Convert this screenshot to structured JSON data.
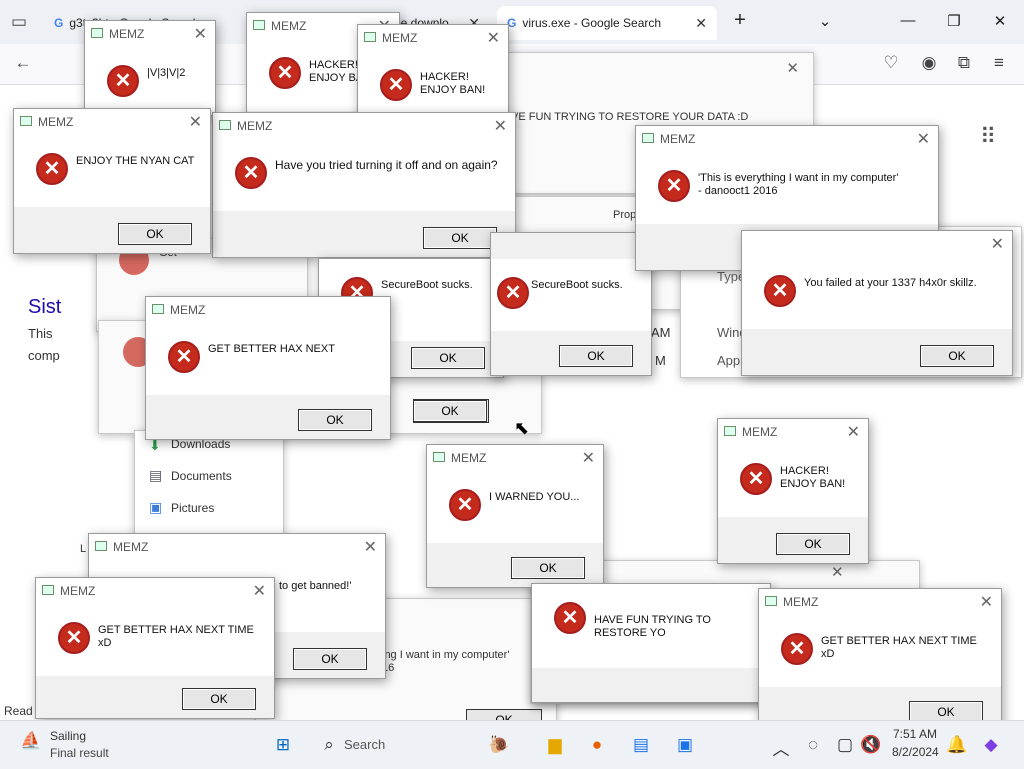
{
  "browser": {
    "tabs": [
      {
        "label": "g3tc3bt - Google Search"
      },
      {
        "label": "ree downlo"
      },
      {
        "label": "virus.exe - Google Search"
      }
    ],
    "new_tab": "+",
    "tab_list": "⌄"
  },
  "background": {
    "heading": "Sist",
    "line1": "This",
    "line2": "comp",
    "get_label": "Get",
    "ok_label": "OK",
    "props": "Prop",
    "type": "Type",
    "am1": "AM",
    "am2": "M",
    "win1": "Wind",
    "win2": "Appl",
    "downloads": "Downloads",
    "documents": "Documents",
    "pictures": "Pictures",
    "letter_l": "L",
    "read": "Read",
    "dialog_text_1": "to get banned!'",
    "dialog_text_2": "ing I want in my computer'\n16",
    "fun_text": "VE FUN TRYING TO RESTORE YOUR DATA :D"
  },
  "dialogs": [
    {
      "title": "MEMZ",
      "message": "|V|3|V|2",
      "ok": "OK"
    },
    {
      "title": "MEMZ",
      "message": "HACKER!\nENJOY BA",
      "ok": "OK"
    },
    {
      "title": "MEMZ",
      "message": "HACKER!\nENJOY BAN!",
      "ok": "OK"
    },
    {
      "title": "MEMZ",
      "message": "ENJOY THE NYAN CAT",
      "ok": "OK"
    },
    {
      "title": "MEMZ",
      "message": "Have you tried turning it off and on again?",
      "ok": "OK"
    },
    {
      "title": "MEMZ",
      "message": "'This is everything I want in my computer'\n - danooct1 2016",
      "ok": "OK"
    },
    {
      "title": "MEMZ",
      "message": "SecureBoot sucks.",
      "ok": "OK"
    },
    {
      "title": "MEMZ",
      "message": "SecureBoot sucks.",
      "ok": "OK"
    },
    {
      "title": "MEMZ",
      "message": "You failed at your 1337 h4x0r skillz.",
      "ok": "OK"
    },
    {
      "title": "MEMZ",
      "message": "GET BETTER HAX NEXT",
      "ok": "OK"
    },
    {
      "title": "MEMZ",
      "message": "I WARNED YOU...",
      "ok": "OK"
    },
    {
      "title": "MEMZ",
      "message": "HACKER!\nENJOY BAN!",
      "ok": "OK"
    },
    {
      "title": "MEMZ",
      "message": "GET BETTER HAX NEXT TIME xD",
      "ok": "OK"
    },
    {
      "title": "MEMZ",
      "message": "HAVE FUN TRYING TO RESTORE YO",
      "ok": "OK"
    },
    {
      "title": "MEMZ",
      "message": "GET BETTER HAX NEXT TIME xD",
      "ok": "OK"
    },
    {
      "title": "MEMZ",
      "message": "",
      "ok": "OK"
    }
  ],
  "taskbar": {
    "weather_title": "Sailing",
    "weather_sub": "Final result",
    "search": "Search",
    "time": "7:51 AM",
    "date": "8/2/2024"
  },
  "icons": {
    "error": "error-x-icon",
    "close": "close-icon"
  }
}
